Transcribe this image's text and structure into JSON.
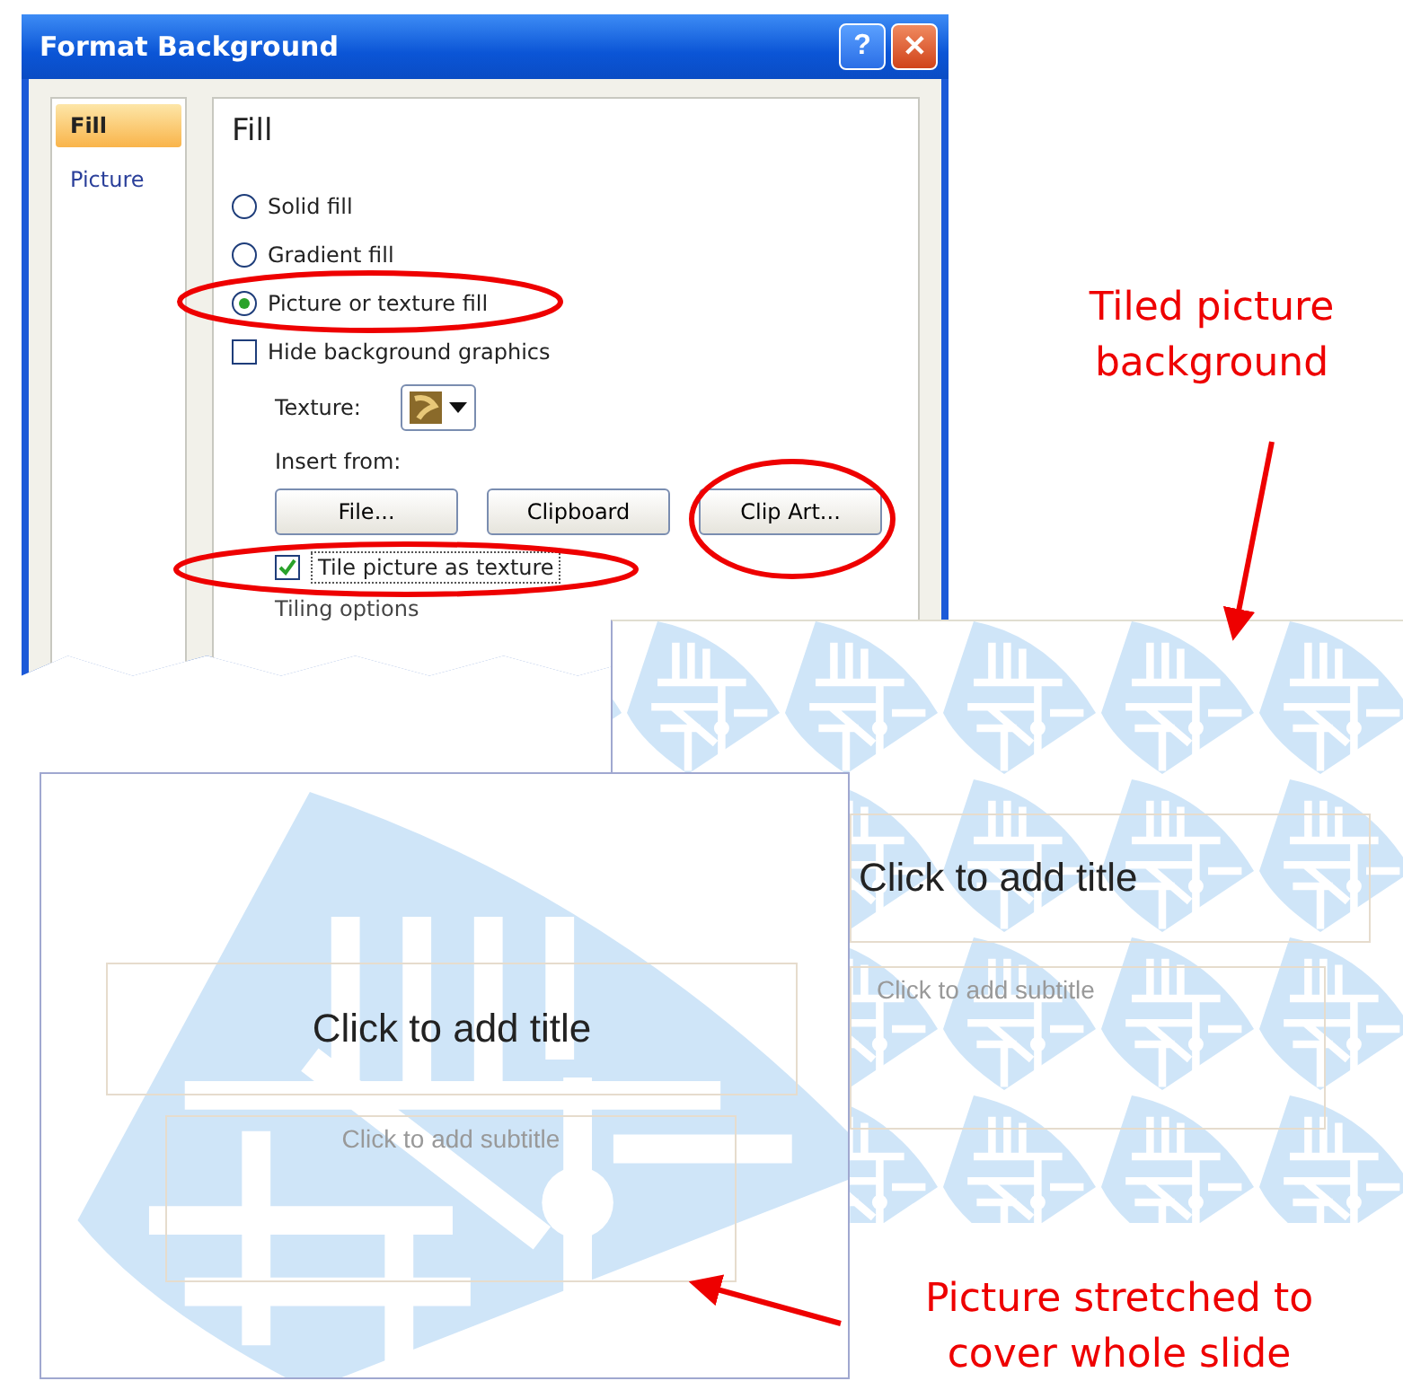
{
  "dialog": {
    "title": "Format Background",
    "title_buttons": [
      {
        "kind": "help",
        "label": "?"
      },
      {
        "kind": "close",
        "label": "✕"
      }
    ],
    "nav": [
      {
        "label": "Fill",
        "selected": true
      },
      {
        "label": "Picture",
        "selected": false
      }
    ],
    "heading": "Fill",
    "fill_options": [
      {
        "label": "Solid fill",
        "selected": false
      },
      {
        "label": "Gradient fill",
        "selected": false
      },
      {
        "label": "Picture or texture fill",
        "selected": true
      }
    ],
    "hide_graphics": {
      "label": "Hide background graphics",
      "checked": false
    },
    "texture": {
      "label": "Texture:"
    },
    "insert_from": {
      "label": "Insert from:",
      "buttons": [
        "File...",
        "Clipboard",
        "Clip Art..."
      ]
    },
    "tile": {
      "label": "Tile picture as texture",
      "checked": true
    },
    "tiling_options": "Tiling options"
  },
  "slides": [
    {
      "kind": "tiled",
      "title": "Click to add title",
      "subtitle": "Click to add subtitle"
    },
    {
      "kind": "stretched",
      "title": "Click to add title",
      "subtitle": "Click to add subtitle"
    }
  ],
  "callouts": [
    "Tiled picture\nbackground",
    "Picture stretched to\ncover whole slide"
  ]
}
